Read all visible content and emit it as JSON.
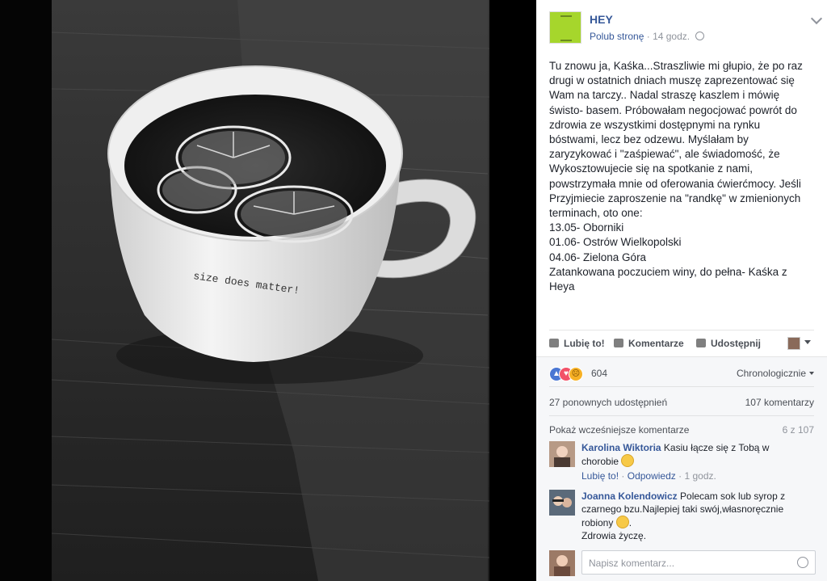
{
  "post": {
    "page_name": "HEY",
    "like_page": "Polub stronę",
    "separator": "·",
    "time": "14 godz.",
    "lines": [
      "Tu znowu ja, Kaśka...Straszliwie mi głupio, że po raz",
      "drugi w ostatnich dniach muszę zaprezentować się",
      "Wam na tarczy.. Nadal straszę kaszlem i mówię",
      "świsto- basem. Próbowałam negocjować powrót do",
      "zdrowia ze wszystkimi dostępnymi na rynku",
      "bóstwami, lecz bez odzewu. Myślałam by",
      "zaryzykować i \"zaśpiewać\", ale świadomość, że",
      "Wykosztowujecie się na spotkanie z nami,",
      "powstrzymała mnie od oferowania ćwierćmocy. Jeśli",
      "Przyjmiecie zaproszenie na \"randkę\" w zmienionych",
      "terminach, oto one:",
      "13.05- Oborniki",
      "01.06- Ostrów Wielkopolski",
      "04.06- Zielona Góra",
      "Zatankowana poczuciem winy, do pełna- Kaśka z",
      "Heya"
    ]
  },
  "photo": {
    "mug_text": "size does matter!"
  },
  "actions": {
    "like": "Lubię to!",
    "comment": "Komentarze",
    "share": "Udostępnij"
  },
  "feedback": {
    "reaction_count": "604",
    "order": "Chronologicznie",
    "shares": "27 ponownych udostępnień",
    "comments_count": "107 komentarzy",
    "show_previous": "Pokaż wcześniejsze komentarze",
    "previous_count": "6 z 107"
  },
  "comments": [
    {
      "name": "Karolina Wiktoria",
      "line1": "Kasiu łącze się z Tobą w",
      "line2": "chorobie",
      "like": "Lubię to!",
      "reply": "Odpowiedz",
      "time": "1 godz."
    },
    {
      "name": "Joanna Kolendowicz",
      "line1": "Polecam sok lub syrop z",
      "line2": "czarnego bzu.Najlepiej taki swój,własnoręcznie",
      "line3": "robiony",
      "line3b": ".",
      "line4": "Zdrowia życzę."
    }
  ],
  "composer": {
    "placeholder": "Napisz komentarz..."
  },
  "colors": {
    "link": "#365899",
    "page_logo": "#a6d62c",
    "panel_bg": "#ffffff",
    "feedback_bg": "#f6f7f9"
  },
  "icons": [
    "globe-icon",
    "chevron-down-icon",
    "thumbs-up-icon",
    "comment-icon",
    "share-icon",
    "like-reaction-icon",
    "love-reaction-icon",
    "sad-reaction-icon",
    "emoji-icon",
    "smiley-icon"
  ]
}
